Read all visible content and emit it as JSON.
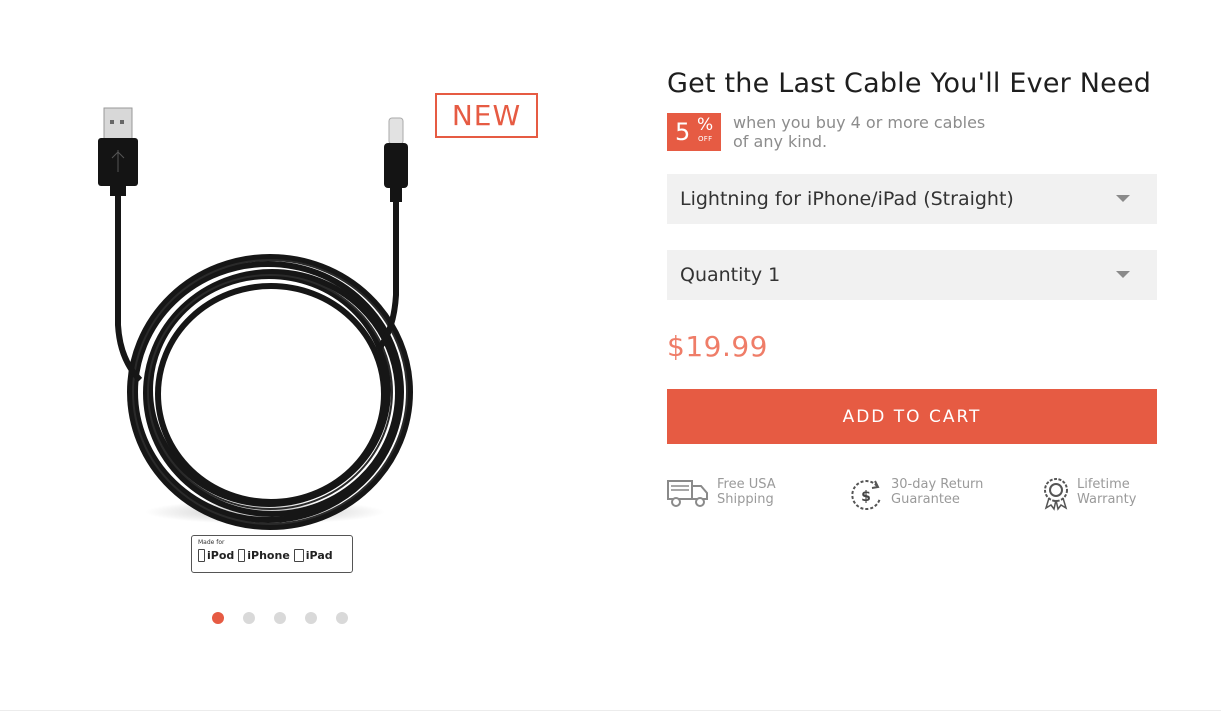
{
  "gallery": {
    "badge_label": "NEW",
    "mfi": {
      "made_for": "Made for",
      "devices": [
        "iPod",
        "iPhone",
        "iPad"
      ]
    },
    "slides_total": 5,
    "active_slide": 1
  },
  "product": {
    "title": "Get the Last Cable You'll Ever Need",
    "promo": {
      "discount_number": "5",
      "discount_symbol": "%",
      "discount_suffix": "OFF",
      "text_line1": "when you buy 4 or more cables",
      "text_line2": "of any kind."
    },
    "connector_select": {
      "value": "Lightning for iPhone/iPad (Straight)"
    },
    "quantity_select": {
      "value": "Quantity 1"
    },
    "price": "$19.99",
    "add_to_cart_label": "ADD TO CART",
    "features": [
      {
        "icon": "truck-icon",
        "line1": "Free USA",
        "line2": "Shipping"
      },
      {
        "icon": "return-dollar-icon",
        "line1": "30-day Return",
        "line2": "Guarantee"
      },
      {
        "icon": "warranty-seal-icon",
        "line1": "Lifetime",
        "line2": "Warranty"
      }
    ]
  },
  "colors": {
    "accent": "#e65b43",
    "price": "#ef7d68",
    "select_bg": "#f1f1f1"
  }
}
